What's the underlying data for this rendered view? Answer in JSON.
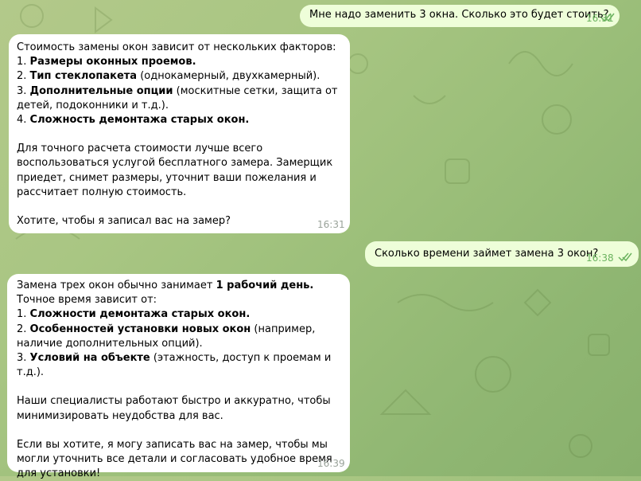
{
  "messages": [
    {
      "direction": "out",
      "text": "Мне надо заменить 3 окна. Сколько это будет стоить?",
      "time": "16:31",
      "read": true
    },
    {
      "direction": "in",
      "intro": "Стоимость замены окон зависит от нескольких факторов:",
      "items": [
        {
          "num": "1. ",
          "bold": "Размеры оконных проемов.",
          "rest": ""
        },
        {
          "num": "2. ",
          "bold": "Тип стеклопакета",
          "rest": " (однокамерный, двухкамерный)."
        },
        {
          "num": "3. ",
          "bold": "Дополнительные опции",
          "rest": " (москитные сетки, защита от детей, подоконники и т.д.)."
        },
        {
          "num": "4. ",
          "bold": "Сложность демонтажа старых окон.",
          "rest": ""
        }
      ],
      "para1": "Для точного расчета стоимости лучше всего воспользоваться услугой бесплатного замера. Замерщик приедет, снимет размеры, уточнит ваши пожелания и рассчитает полную стоимость.",
      "para2": "Хотите, чтобы я записал вас на замер?",
      "time": "16:31"
    },
    {
      "direction": "out",
      "text": "Сколько времени займет замена 3 окон?",
      "time": "16:38",
      "read": true
    },
    {
      "direction": "in",
      "intro_pre": "Замена трех окон обычно занимает ",
      "intro_bold": "1 рабочий день.",
      "intro_post": " Точное время зависит от:",
      "items": [
        {
          "num": "1. ",
          "bold": "Сложности демонтажа старых окон.",
          "rest": ""
        },
        {
          "num": "2. ",
          "bold": "Особенностей установки новых окон",
          "rest": " (например, наличие дополнительных опций)."
        },
        {
          "num": "3. ",
          "bold": "Условий на объекте",
          "rest": " (этажность, доступ к проемам и т.д.)."
        }
      ],
      "para1": "Наши специалисты работают быстро и аккуратно, чтобы минимизировать неудобства для вас.",
      "para2": "Если вы хотите, я могу записать вас на замер, чтобы мы могли уточнить все детали и согласовать удобное время для установки!",
      "time": "16:39"
    }
  ],
  "colors": {
    "outgoing_bubble": "#eefed9",
    "incoming_bubble": "#ffffff",
    "read_ticks": "#6bb35f"
  }
}
